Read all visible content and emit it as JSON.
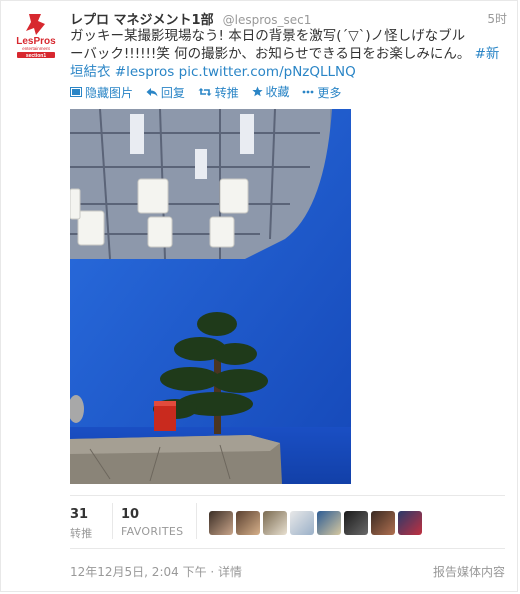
{
  "account": {
    "name": "レプロ マネジメント1部",
    "handle": "@lespros_sec1",
    "time": "5时",
    "avatar_text_top": "LesPros",
    "avatar_text_mid": "entertainment",
    "avatar_text_bottom": "section1"
  },
  "tweet": {
    "text_line1": "ガッキー某撮影現場なう! 本日の背景を激写(´▽`)ノ怪しげなブル",
    "text_line2": "ーバック!!!!!!笑 何の撮影か、お知らせできる日をお楽しみにん。",
    "hashtag1": "#新",
    "hashtag1_cont": "垣結衣",
    "hashtag2": "#lespros",
    "link": "pic.twitter.com/pNzQLLNQ"
  },
  "actions": {
    "hide_media": "隐藏图片",
    "reply": "回复",
    "retweet": "转推",
    "favorite": "收藏",
    "more": "更多"
  },
  "stats": {
    "retweets_count": "31",
    "retweets_label": "转推",
    "favorites_count": "10",
    "favorites_label": "FAVORITES"
  },
  "footer": {
    "timestamp": "12年12月5日, 2:04 下午",
    "details": "详情",
    "report": "报告媒体内容"
  },
  "colors": {
    "link": "#2a85c6",
    "muted": "#999999",
    "bluescreen": "#1f5fd6",
    "brand_red": "#d7282f"
  }
}
